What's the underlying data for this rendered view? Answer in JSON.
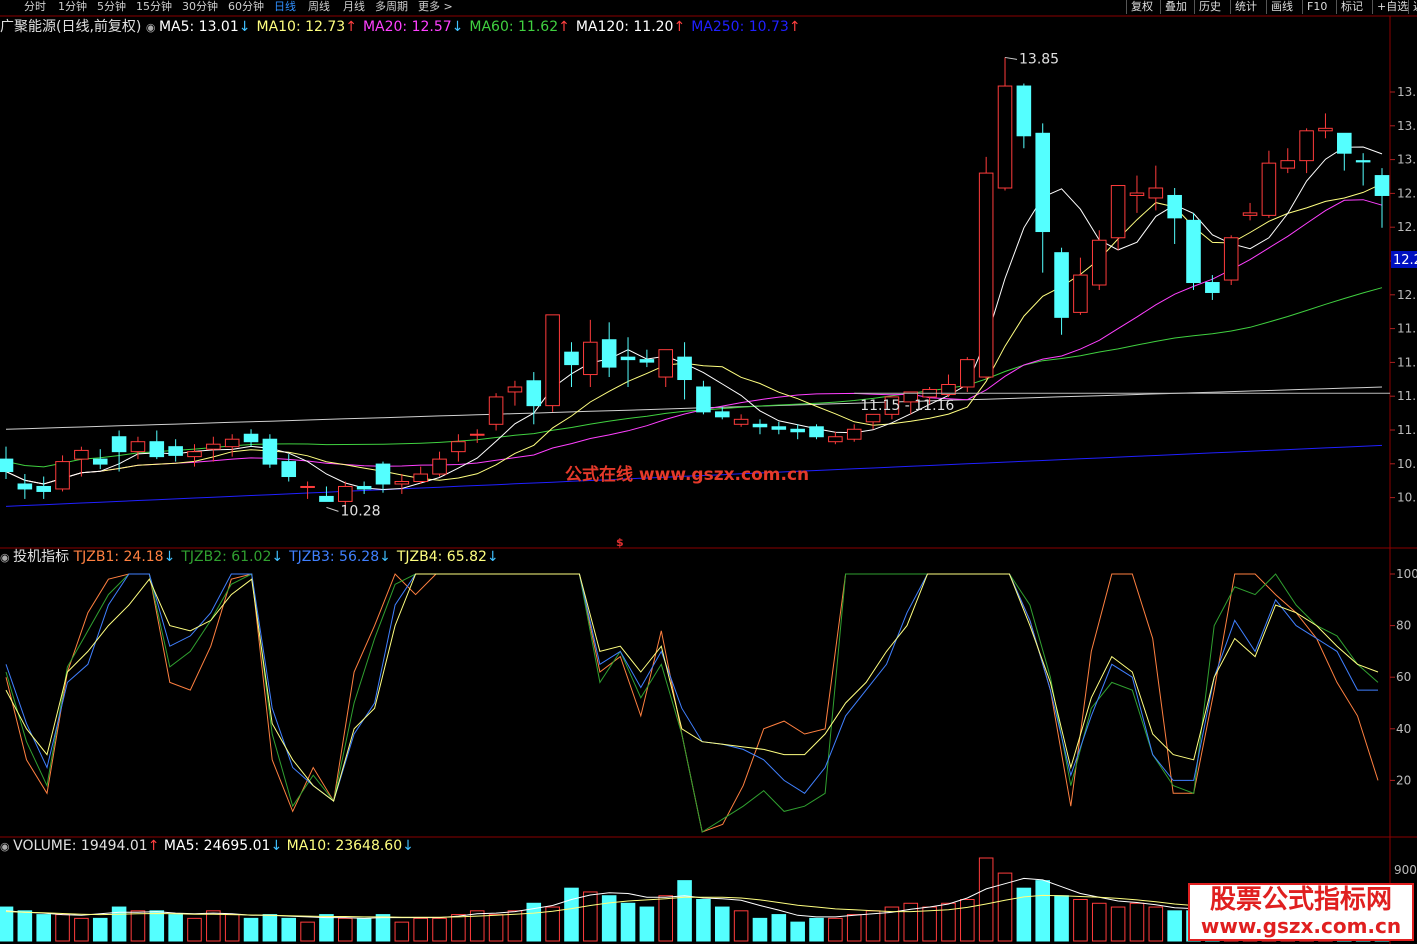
{
  "toolbar": {
    "periods": [
      "分时",
      "1分钟",
      "5分钟",
      "15分钟",
      "30分钟",
      "60分钟",
      "日线",
      "周线",
      "月线",
      "多周期",
      "更多 >"
    ],
    "active": "日线",
    "right_buttons": [
      "复权",
      "叠加",
      "历史",
      "统计",
      "画线",
      "F10",
      "标记",
      "+自选",
      "返"
    ]
  },
  "price_panel": {
    "stock_label": "广聚能源(日线,前复权)",
    "ma": [
      {
        "name": "MA5",
        "value": "13.01",
        "dir": "down",
        "color": "#ffffff"
      },
      {
        "name": "MA10",
        "value": "12.73",
        "dir": "up",
        "color": "#ffff80"
      },
      {
        "name": "MA20",
        "value": "12.57",
        "dir": "down",
        "color": "#ff40ff"
      },
      {
        "name": "MA60",
        "value": "11.62",
        "dir": "up",
        "color": "#40d040"
      },
      {
        "name": "MA120",
        "value": "11.20",
        "dir": "up",
        "color": "#ffffff"
      },
      {
        "name": "MA250",
        "value": "10.73",
        "dir": "up",
        "color": "#2020ff"
      }
    ],
    "high_mark": "13.85",
    "low_mark": "10.28",
    "range_mark": "11.15 - 11.16",
    "current_price_tag": "12.2",
    "axis_ticks": [
      "13.",
      "13.",
      "13.",
      "12.",
      "12.",
      "12.",
      "12.",
      "11.",
      "11.",
      "11.",
      "11.",
      "10.",
      "10."
    ]
  },
  "indicator_panel": {
    "name": "投机指标",
    "lines": [
      {
        "name": "TJZB1",
        "value": "24.18",
        "dir": "down",
        "color": "#ff8040"
      },
      {
        "name": "TJZB2",
        "value": "61.02",
        "dir": "down",
        "color": "#30a030"
      },
      {
        "name": "TJZB3",
        "value": "56.28",
        "dir": "down",
        "color": "#4080ff"
      },
      {
        "name": "TJZB4",
        "value": "65.82",
        "dir": "down",
        "color": "#ffff80"
      }
    ],
    "axis_ticks": [
      "100",
      "80",
      "60",
      "40",
      "20"
    ]
  },
  "volume_panel": {
    "label": "VOLUME",
    "value": "19494.01",
    "dir": "up",
    "ma5_label": "MA5",
    "ma5_value": "24695.01",
    "ma5_dir": "down",
    "ma10_label": "MA10",
    "ma10_value": "23648.60",
    "ma10_dir": "down",
    "axis_tick": "900"
  },
  "watermarks": {
    "center": "公式在线  www.gszx.com.cn",
    "badge_line1": "股票公式指标网",
    "badge_line2": "www.gszx.com.cn",
    "dollar": "$"
  },
  "colors": {
    "up": "#ff3c3c",
    "down": "#54ffff",
    "ma5": "#ffffff",
    "ma10": "#ffff80",
    "ma20": "#ff40ff",
    "ma60": "#40d040",
    "ma120": "#d0d0d0",
    "ma250": "#2020ff"
  },
  "chart_data": [
    {
      "type": "candlestick",
      "title": "广聚能源(日线,前复权)",
      "candles": [
        {
          "o": 10.62,
          "h": 10.72,
          "l": 10.46,
          "c": 10.52
        },
        {
          "o": 10.42,
          "h": 10.5,
          "l": 10.3,
          "c": 10.38
        },
        {
          "o": 10.4,
          "h": 10.48,
          "l": 10.3,
          "c": 10.36
        },
        {
          "o": 10.38,
          "h": 10.65,
          "l": 10.36,
          "c": 10.6
        },
        {
          "o": 10.62,
          "h": 10.72,
          "l": 10.48,
          "c": 10.69
        },
        {
          "o": 10.62,
          "h": 10.7,
          "l": 10.54,
          "c": 10.58
        },
        {
          "o": 10.8,
          "h": 10.85,
          "l": 10.52,
          "c": 10.68
        },
        {
          "o": 10.68,
          "h": 10.8,
          "l": 10.62,
          "c": 10.76
        },
        {
          "o": 10.76,
          "h": 10.85,
          "l": 10.62,
          "c": 10.64
        },
        {
          "o": 10.72,
          "h": 10.78,
          "l": 10.6,
          "c": 10.65
        },
        {
          "o": 10.64,
          "h": 10.74,
          "l": 10.56,
          "c": 10.68
        },
        {
          "o": 10.7,
          "h": 10.8,
          "l": 10.6,
          "c": 10.74
        },
        {
          "o": 10.72,
          "h": 10.82,
          "l": 10.64,
          "c": 10.78
        },
        {
          "o": 10.82,
          "h": 10.86,
          "l": 10.72,
          "c": 10.76
        },
        {
          "o": 10.78,
          "h": 10.82,
          "l": 10.55,
          "c": 10.58
        },
        {
          "o": 10.6,
          "h": 10.66,
          "l": 10.44,
          "c": 10.48
        },
        {
          "o": 10.4,
          "h": 10.44,
          "l": 10.3,
          "c": 10.4
        },
        {
          "o": 10.32,
          "h": 10.4,
          "l": 10.28,
          "c": 10.28
        },
        {
          "o": 10.28,
          "h": 10.44,
          "l": 10.2,
          "c": 10.4
        },
        {
          "o": 10.4,
          "h": 10.44,
          "l": 10.34,
          "c": 10.38
        },
        {
          "o": 10.58,
          "h": 10.6,
          "l": 10.35,
          "c": 10.42
        },
        {
          "o": 10.42,
          "h": 10.5,
          "l": 10.34,
          "c": 10.44
        },
        {
          "o": 10.44,
          "h": 10.56,
          "l": 10.42,
          "c": 10.5
        },
        {
          "o": 10.5,
          "h": 10.68,
          "l": 10.48,
          "c": 10.62
        },
        {
          "o": 10.68,
          "h": 10.82,
          "l": 10.6,
          "c": 10.76
        },
        {
          "o": 10.82,
          "h": 10.86,
          "l": 10.75,
          "c": 10.82
        },
        {
          "o": 10.9,
          "h": 11.15,
          "l": 10.85,
          "c": 11.12
        },
        {
          "o": 11.16,
          "h": 11.25,
          "l": 11.05,
          "c": 11.2
        },
        {
          "o": 11.25,
          "h": 11.32,
          "l": 10.9,
          "c": 11.05
        },
        {
          "o": 11.05,
          "h": 11.78,
          "l": 11.0,
          "c": 11.78
        },
        {
          "o": 11.48,
          "h": 11.56,
          "l": 11.2,
          "c": 11.38
        },
        {
          "o": 11.3,
          "h": 11.74,
          "l": 11.2,
          "c": 11.56
        },
        {
          "o": 11.58,
          "h": 11.72,
          "l": 11.28,
          "c": 11.36
        },
        {
          "o": 11.44,
          "h": 11.6,
          "l": 11.2,
          "c": 11.42
        },
        {
          "o": 11.42,
          "h": 11.5,
          "l": 11.36,
          "c": 11.4
        },
        {
          "o": 11.28,
          "h": 11.5,
          "l": 11.2,
          "c": 11.5
        },
        {
          "o": 11.44,
          "h": 11.56,
          "l": 11.1,
          "c": 11.26
        },
        {
          "o": 11.2,
          "h": 11.25,
          "l": 10.98,
          "c": 11.0
        },
        {
          "o": 11.0,
          "h": 11.04,
          "l": 10.94,
          "c": 10.96
        },
        {
          "o": 10.9,
          "h": 10.98,
          "l": 10.88,
          "c": 10.94
        },
        {
          "o": 10.9,
          "h": 10.94,
          "l": 10.82,
          "c": 10.88
        },
        {
          "o": 10.88,
          "h": 10.92,
          "l": 10.82,
          "c": 10.86
        },
        {
          "o": 10.86,
          "h": 10.9,
          "l": 10.78,
          "c": 10.84
        },
        {
          "o": 10.88,
          "h": 10.9,
          "l": 10.78,
          "c": 10.8
        },
        {
          "o": 10.76,
          "h": 10.84,
          "l": 10.74,
          "c": 10.8
        },
        {
          "o": 10.78,
          "h": 10.9,
          "l": 10.76,
          "c": 10.86
        },
        {
          "o": 10.92,
          "h": 10.98,
          "l": 10.86,
          "c": 10.98
        },
        {
          "o": 10.98,
          "h": 11.08,
          "l": 10.94,
          "c": 11.12
        },
        {
          "o": 11.08,
          "h": 11.14,
          "l": 10.98,
          "c": 11.16
        },
        {
          "o": 11.12,
          "h": 11.2,
          "l": 11.06,
          "c": 11.18
        },
        {
          "o": 11.14,
          "h": 11.3,
          "l": 11.12,
          "c": 11.22
        },
        {
          "o": 11.2,
          "h": 11.44,
          "l": 11.16,
          "c": 11.42
        },
        {
          "o": 11.28,
          "h": 13.05,
          "l": 11.26,
          "c": 12.92
        },
        {
          "o": 12.8,
          "h": 13.85,
          "l": 12.78,
          "c": 13.62
        },
        {
          "o": 13.62,
          "h": 13.64,
          "l": 13.12,
          "c": 13.22
        },
        {
          "o": 13.24,
          "h": 13.32,
          "l": 12.12,
          "c": 12.45
        },
        {
          "o": 12.28,
          "h": 12.32,
          "l": 11.62,
          "c": 11.76
        },
        {
          "o": 11.8,
          "h": 12.24,
          "l": 11.78,
          "c": 12.1
        },
        {
          "o": 12.02,
          "h": 12.46,
          "l": 11.98,
          "c": 12.38
        },
        {
          "o": 12.4,
          "h": 12.82,
          "l": 12.3,
          "c": 12.82
        },
        {
          "o": 12.74,
          "h": 12.9,
          "l": 12.6,
          "c": 12.76
        },
        {
          "o": 12.72,
          "h": 12.98,
          "l": 12.62,
          "c": 12.8
        },
        {
          "o": 12.74,
          "h": 12.8,
          "l": 12.35,
          "c": 12.56
        },
        {
          "o": 12.54,
          "h": 12.6,
          "l": 11.98,
          "c": 12.04
        },
        {
          "o": 12.04,
          "h": 12.1,
          "l": 11.9,
          "c": 11.96
        },
        {
          "o": 12.06,
          "h": 12.42,
          "l": 12.02,
          "c": 12.4
        },
        {
          "o": 12.58,
          "h": 12.68,
          "l": 12.54,
          "c": 12.6
        },
        {
          "o": 12.58,
          "h": 13.1,
          "l": 12.56,
          "c": 13.0
        },
        {
          "o": 12.96,
          "h": 13.12,
          "l": 12.92,
          "c": 13.02
        },
        {
          "o": 13.02,
          "h": 13.28,
          "l": 12.92,
          "c": 13.26
        },
        {
          "o": 13.26,
          "h": 13.4,
          "l": 13.2,
          "c": 13.28
        },
        {
          "o": 13.24,
          "h": 13.2,
          "l": 12.94,
          "c": 13.08
        },
        {
          "o": 13.02,
          "h": 13.08,
          "l": 12.82,
          "c": 13.01
        },
        {
          "o": 12.9,
          "h": 12.96,
          "l": 12.48,
          "c": 12.74
        }
      ],
      "ma_lines_visible": [
        "MA5",
        "MA10",
        "MA20",
        "MA60",
        "MA120",
        "MA250"
      ]
    },
    {
      "type": "line",
      "title": "投机指标",
      "ylim": [
        0,
        100
      ],
      "series": [
        {
          "name": "TJZB1",
          "values": [
            60,
            28,
            15,
            62,
            85,
            98,
            100,
            100,
            58,
            55,
            72,
            98,
            100,
            28,
            8,
            25,
            12,
            62,
            80,
            100,
            92,
            100,
            100,
            100,
            100,
            100,
            100,
            100,
            100,
            62,
            68,
            45,
            78,
            38,
            0,
            3,
            18,
            40,
            43,
            38,
            40,
            100,
            100,
            100,
            100,
            100,
            100,
            100,
            100,
            100,
            82,
            55,
            10,
            70,
            100,
            100,
            75,
            15,
            15,
            55,
            100,
            100,
            92,
            85,
            75,
            58,
            45,
            20
          ]
        },
        {
          "name": "TJZB2",
          "values": [
            62,
            35,
            18,
            64,
            78,
            92,
            100,
            100,
            64,
            70,
            82,
            96,
            100,
            38,
            10,
            22,
            12,
            50,
            75,
            96,
            100,
            100,
            100,
            100,
            100,
            100,
            100,
            100,
            100,
            58,
            70,
            52,
            65,
            38,
            0,
            5,
            10,
            16,
            8,
            10,
            15,
            100,
            100,
            100,
            100,
            100,
            100,
            100,
            100,
            100,
            88,
            60,
            18,
            48,
            58,
            55,
            30,
            18,
            15,
            80,
            95,
            92,
            100,
            88,
            80,
            76,
            65,
            58
          ]
        },
        {
          "name": "TJZB3",
          "values": [
            65,
            42,
            25,
            58,
            65,
            88,
            100,
            100,
            72,
            76,
            85,
            100,
            100,
            48,
            25,
            18,
            12,
            38,
            50,
            88,
            100,
            100,
            100,
            100,
            100,
            100,
            100,
            100,
            100,
            65,
            70,
            56,
            70,
            48,
            35,
            34,
            32,
            28,
            20,
            15,
            25,
            45,
            55,
            65,
            85,
            100,
            100,
            100,
            100,
            100,
            82,
            55,
            22,
            45,
            65,
            60,
            30,
            20,
            20,
            60,
            82,
            70,
            90,
            80,
            75,
            70,
            55,
            55
          ]
        },
        {
          "name": "TJZB4",
          "values": [
            55,
            40,
            30,
            62,
            70,
            80,
            88,
            98,
            80,
            78,
            82,
            92,
            98,
            42,
            28,
            18,
            12,
            40,
            48,
            80,
            100,
            100,
            100,
            100,
            100,
            100,
            100,
            100,
            100,
            70,
            72,
            62,
            72,
            40,
            35,
            34,
            33,
            32,
            30,
            30,
            38,
            50,
            58,
            70,
            80,
            100,
            100,
            100,
            100,
            100,
            80,
            58,
            25,
            52,
            68,
            62,
            38,
            30,
            28,
            60,
            75,
            68,
            88,
            85,
            80,
            72,
            65,
            62
          ]
        }
      ],
      "yticks": [
        100,
        80,
        60,
        40,
        20
      ]
    },
    {
      "type": "bar",
      "title": "VOLUME",
      "values": [
        9,
        8,
        7,
        7,
        6,
        6,
        9,
        8,
        8,
        7,
        6,
        8,
        7,
        6,
        7,
        6,
        5,
        7,
        6,
        6,
        7,
        5,
        6,
        6,
        7,
        8,
        7,
        8,
        10,
        9,
        14,
        13,
        12,
        10,
        9,
        12,
        16,
        11,
        9,
        8,
        6,
        7,
        5,
        6,
        6,
        7,
        8,
        9,
        10,
        9,
        10,
        11,
        22,
        18,
        14,
        16,
        12,
        11,
        10,
        9,
        10,
        9,
        8,
        8,
        7,
        9,
        8,
        8,
        12,
        10,
        9,
        7,
        8,
        7
      ],
      "ma5": [
        8,
        7.6,
        7.4,
        7,
        6.8,
        7.2,
        7.6,
        7.6,
        7.8,
        7.4,
        7.2,
        7.4,
        7.2,
        6.8,
        6.8,
        6.6,
        6.4,
        6.2,
        6.2,
        6,
        6.2,
        6.2,
        6.2,
        6.2,
        6.6,
        7.2,
        7.4,
        7.8,
        8.6,
        9.4,
        11,
        12.2,
        12.8,
        12.6,
        11.6,
        11.6,
        12,
        11.4,
        11.2,
        10.8,
        9.4,
        8.2,
        6.8,
        6.4,
        6.4,
        6.8,
        7.2,
        7.6,
        8.4,
        9,
        9.8,
        11.4,
        13.8,
        15.2,
        16.6,
        16.2,
        14.4,
        12.6,
        11.6,
        10.6,
        10.2,
        9.6,
        8.8,
        8.6,
        8.4,
        8.4,
        8.2,
        8.6,
        9.2,
        9.6,
        9.8,
        9.6,
        9.2,
        8.4
      ],
      "ma10": [
        7.8,
        7.6,
        7.5,
        7.3,
        7.1,
        7,
        7.1,
        7.2,
        7.3,
        7.2,
        7.1,
        7.1,
        7,
        6.9,
        6.8,
        6.7,
        6.6,
        6.5,
        6.5,
        6.4,
        6.4,
        6.3,
        6.3,
        6.3,
        6.4,
        6.6,
        6.8,
        7.1,
        7.4,
        7.9,
        8.6,
        9.4,
        10.1,
        10.6,
        10.9,
        11.2,
        11.6,
        11.6,
        11.6,
        11.4,
        10.9,
        10.2,
        9.5,
        9,
        8.5,
        8.3,
        8,
        7.8,
        7.8,
        8,
        8.3,
        8.9,
        9.8,
        10.8,
        11.7,
        12.1,
        12,
        11.8,
        11.6,
        11.3,
        10.9,
        10.4,
        9.8,
        9.4,
        9,
        8.9,
        8.7,
        8.6,
        8.7,
        8.9,
        9,
        9.1,
        9.1,
        9
      ]
    }
  ]
}
